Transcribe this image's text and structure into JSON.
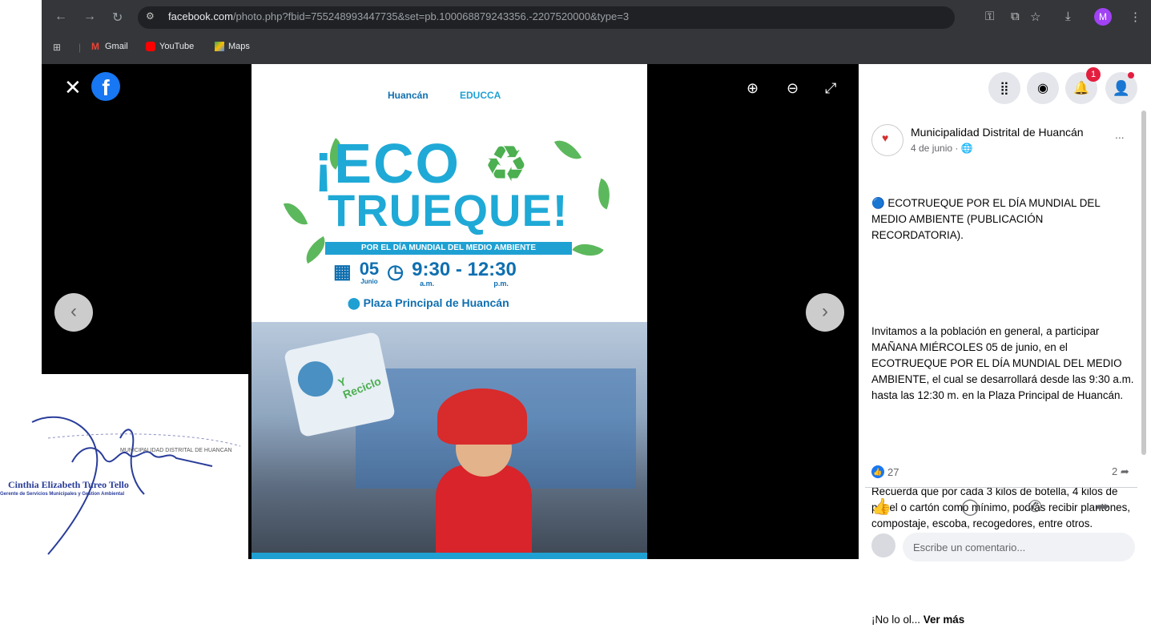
{
  "browser": {
    "url_host": "facebook.com",
    "url_rest": "/photo.php?fbid=755248993447735&set=pb.100068879243356.-2207520000&type=3",
    "profile_initial": "M",
    "bookmarks": [
      {
        "label": "Gmail",
        "icon": "gmail-icon",
        "color": "#ea4335"
      },
      {
        "label": "YouTube",
        "icon": "youtube-icon",
        "color": "#ff0000"
      },
      {
        "label": "Maps",
        "icon": "maps-icon",
        "color": "#34a853"
      }
    ]
  },
  "poster": {
    "logo1": "Huancán",
    "logo2": "EDUCCA",
    "eco": "¡ECO",
    "trueque": "TRUEQUE!",
    "banner": "POR EL DÍA MUNDIAL DEL MEDIO AMBIENTE",
    "day": "05",
    "month": "Junio",
    "time": "9:30 - 12:30",
    "am": "a.m.",
    "pm": "p.m.",
    "place": "Plaza Principal de Huancán",
    "sign_text": "Y Reciclo"
  },
  "viewer": {
    "close": "✕",
    "zoom_in": "⊕",
    "zoom_out": "⊖",
    "expand": "⤢",
    "prev": "‹",
    "next": "›"
  },
  "signature": {
    "name": "Cinthia Elizabeth Tureo Tello",
    "role": "Gerente de Servicios Municipales y Gestion Ambiental",
    "stamp": "MUNICIPALIDAD DISTRITAL DE HUANCAN"
  },
  "panel": {
    "notification_count": "1",
    "page_name": "Municipalidad Distrital de Huancán",
    "date": "4 de junio · 🌐",
    "more": "...",
    "text_p1": "🔵 ECOTRUEQUE POR EL DÍA MUNDIAL DEL MEDIO AMBIENTE (PUBLICACIÓN RECORDATORIA).",
    "text_p2": "Invitamos a la población en general, a participar MAÑANA MIÉRCOLES 05 de junio, en el ECOTRUEQUE POR EL DÍA MUNDIAL DEL MEDIO AMBIENTE, el cual se desarrollará desde las 9:30 a.m. hasta las 12:30 m. en la Plaza Principal de Huancán.",
    "text_p3": "Recuerda que por cada 3 kilos de botella, 4 kilos de papel o cartón como mínimo, podrás recibir plantones, compostaje, escoba, recogedores, entre otros.",
    "text_p4": "¡No lo ol...",
    "see_more": "Ver más",
    "like_count": "27",
    "share_count": "2",
    "comment_placeholder": "Escribe un comentario..."
  }
}
